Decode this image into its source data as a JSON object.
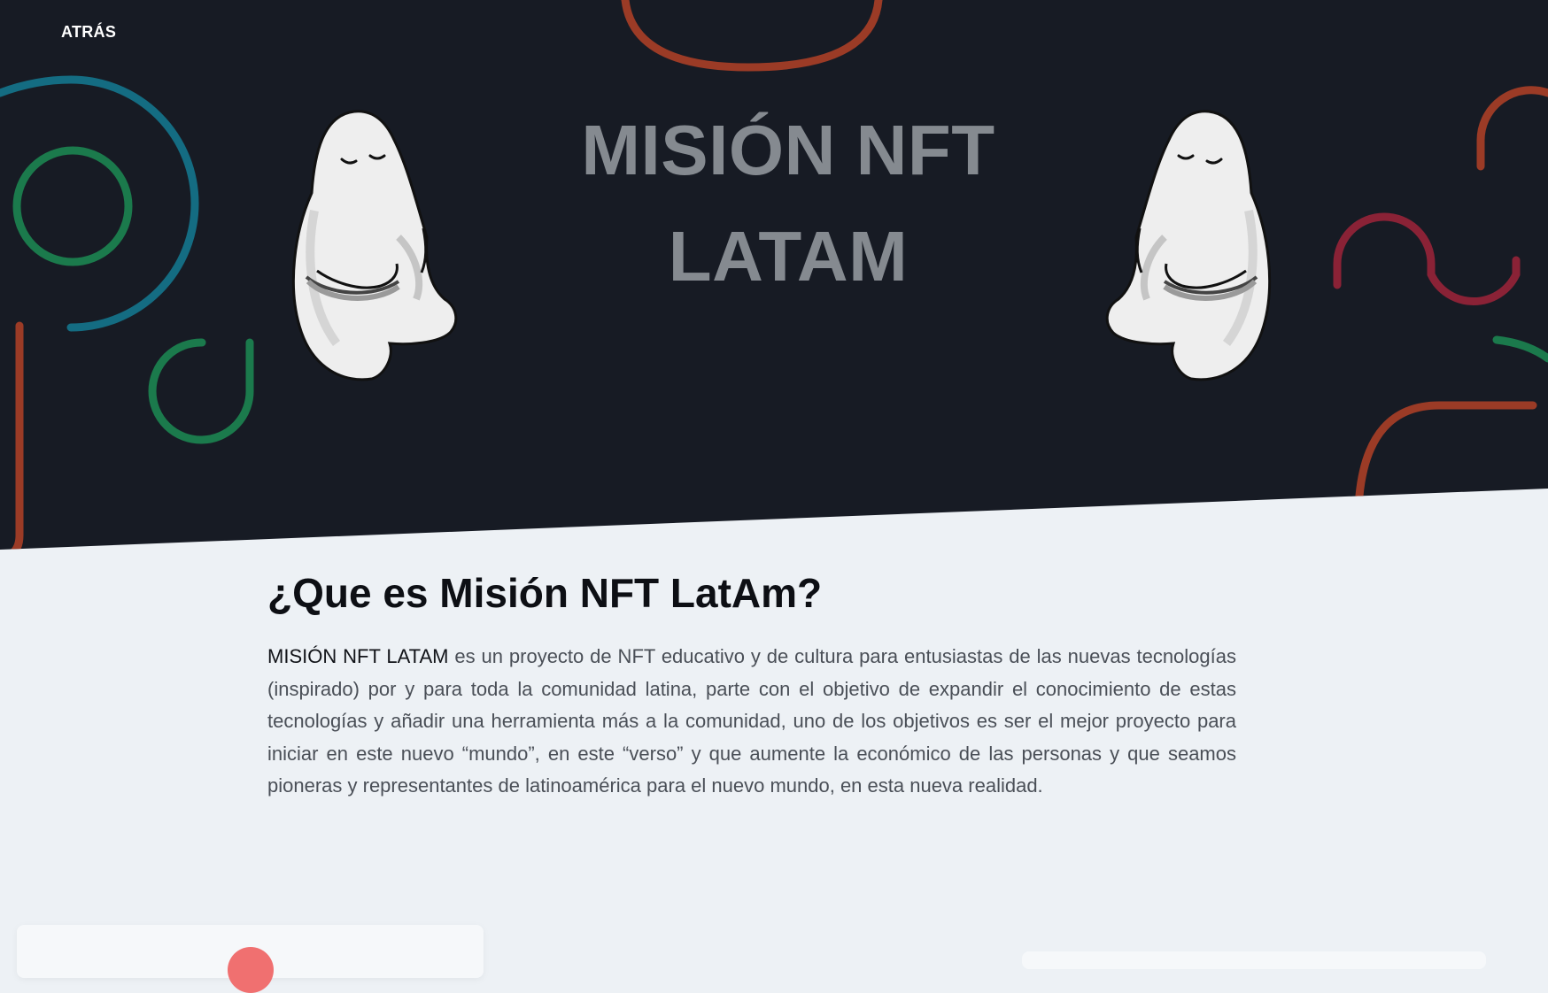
{
  "nav": {
    "back_label": "ATRÁS"
  },
  "hero": {
    "title": "MISIÓN NFT LATAM"
  },
  "about": {
    "heading": "¿Que es Misión NFT LatAm?",
    "lead": "MISIÓN NFT LATAM",
    "body": " es un proyecto de NFT educativo y de cultura para entusiastas de las nuevas tecnologías (inspirado) por y para toda la comunidad latina, parte con el objetivo de expandir el conocimiento de estas tecnologías y añadir una herramienta más a la comunidad, uno de los objetivos es ser el mejor proyecto para iniciar en este nuevo “mundo”, en este “verso” y que aumente la económico de las personas y que seamos pioneras y representantes de latinoamérica para el nuevo mundo, en esta nueva realidad."
  },
  "colors": {
    "hero_bg": "#171b24",
    "page_bg": "#edf1f5",
    "title": "#858a90",
    "rust": "#9b3b26",
    "teal": "#146c82",
    "green": "#1b7a4c",
    "crimson": "#8a2236",
    "card_dot": "#f07070"
  },
  "icons": {
    "mascot": "ghost-mascot-icon"
  }
}
